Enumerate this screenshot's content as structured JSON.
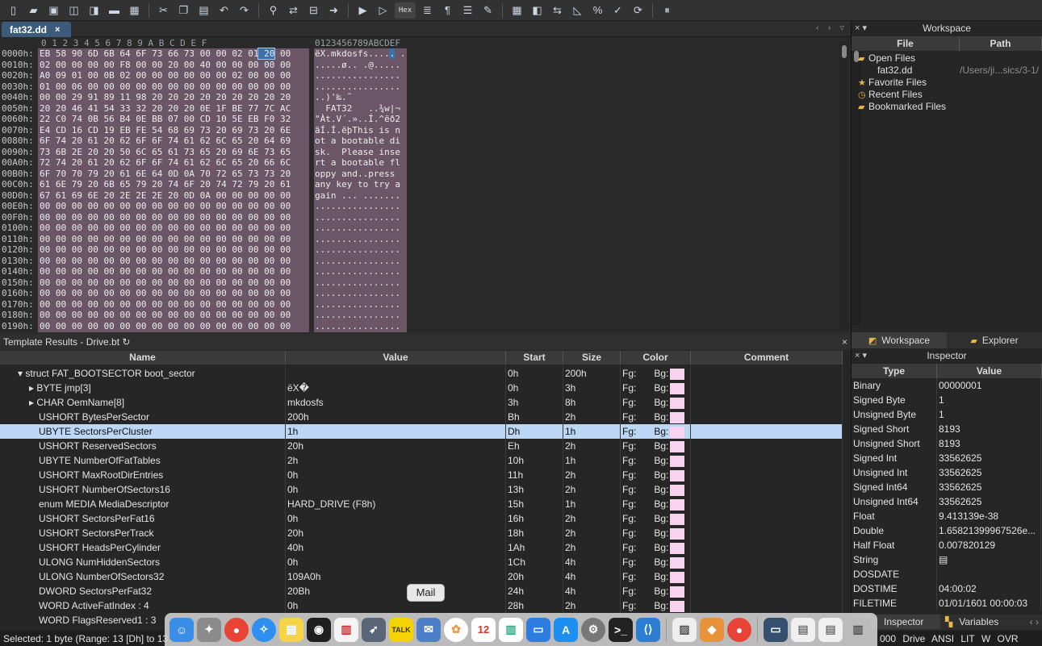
{
  "toolbar": {
    "hex_label": "Hex"
  },
  "editor": {
    "tab_label": "fat32.dd",
    "tab_close": "×",
    "tab_nav": "‹ › ▿"
  },
  "hex_view": {
    "column_header": "0  1  2  3  4  5  6  7  8  9  A  B  C  D  E  F",
    "ascii_header": "0123456789ABCDEF",
    "rows": [
      {
        "addr": "0000h:",
        "hex": "EB 58 90 6D 6B 64 6F 73 66 73 00 00 02 01 20 00",
        "ascii": "ëX.mkdosfs..... ."
      },
      {
        "addr": "0010h:",
        "hex": "02 00 00 00 00 F8 00 00 20 00 40 00 00 00 00 00",
        "ascii": ".....ø.. .@....."
      },
      {
        "addr": "0020h:",
        "hex": "A0 09 01 00 0B 02 00 00 00 00 00 00 02 00 00 00",
        "ascii": "................"
      },
      {
        "addr": "0030h:",
        "hex": "01 00 06 00 00 00 00 00 00 00 00 00 00 00 00 00",
        "ascii": "................"
      },
      {
        "addr": "0040h:",
        "hex": "00 00 29 91 89 11 98 20 20 20 20 20 20 20 20 20",
        "ascii": "..)'‰.˜         "
      },
      {
        "addr": "0050h:",
        "hex": "20 20 46 41 54 33 32 20 20 20 0E 1F BE 77 7C AC",
        "ascii": "  FAT32   ..¾w|¬"
      },
      {
        "addr": "0060h:",
        "hex": "22 C0 74 0B 56 B4 0E BB 07 00 CD 10 5E EB F0 32",
        "ascii": "\"Àt.V´.»..Í.^ëð2"
      },
      {
        "addr": "0070h:",
        "hex": "E4 CD 16 CD 19 EB FE 54 68 69 73 20 69 73 20 6E",
        "ascii": "äÍ.Í.ëþThis is n"
      },
      {
        "addr": "0080h:",
        "hex": "6F 74 20 61 20 62 6F 6F 74 61 62 6C 65 20 64 69",
        "ascii": "ot a bootable di"
      },
      {
        "addr": "0090h:",
        "hex": "73 6B 2E 20 20 50 6C 65 61 73 65 20 69 6E 73 65",
        "ascii": "sk.  Please inse"
      },
      {
        "addr": "00A0h:",
        "hex": "72 74 20 61 20 62 6F 6F 74 61 62 6C 65 20 66 6C",
        "ascii": "rt a bootable fl"
      },
      {
        "addr": "00B0h:",
        "hex": "6F 70 70 79 20 61 6E 64 0D 0A 70 72 65 73 73 20",
        "ascii": "oppy and..press "
      },
      {
        "addr": "00C0h:",
        "hex": "61 6E 79 20 6B 65 79 20 74 6F 20 74 72 79 20 61",
        "ascii": "any key to try a"
      },
      {
        "addr": "00D0h:",
        "hex": "67 61 69 6E 20 2E 2E 2E 20 0D 0A 00 00 00 00 00",
        "ascii": "gain ... ......."
      },
      {
        "addr": "00E0h:",
        "hex": "00 00 00 00 00 00 00 00 00 00 00 00 00 00 00 00",
        "ascii": "................"
      },
      {
        "addr": "00F0h:",
        "hex": "00 00 00 00 00 00 00 00 00 00 00 00 00 00 00 00",
        "ascii": "................"
      },
      {
        "addr": "0100h:",
        "hex": "00 00 00 00 00 00 00 00 00 00 00 00 00 00 00 00",
        "ascii": "................"
      },
      {
        "addr": "0110h:",
        "hex": "00 00 00 00 00 00 00 00 00 00 00 00 00 00 00 00",
        "ascii": "................"
      },
      {
        "addr": "0120h:",
        "hex": "00 00 00 00 00 00 00 00 00 00 00 00 00 00 00 00",
        "ascii": "................"
      },
      {
        "addr": "0130h:",
        "hex": "00 00 00 00 00 00 00 00 00 00 00 00 00 00 00 00",
        "ascii": "................"
      },
      {
        "addr": "0140h:",
        "hex": "00 00 00 00 00 00 00 00 00 00 00 00 00 00 00 00",
        "ascii": "................"
      },
      {
        "addr": "0150h:",
        "hex": "00 00 00 00 00 00 00 00 00 00 00 00 00 00 00 00",
        "ascii": "................"
      },
      {
        "addr": "0160h:",
        "hex": "00 00 00 00 00 00 00 00 00 00 00 00 00 00 00 00",
        "ascii": "................"
      },
      {
        "addr": "0170h:",
        "hex": "00 00 00 00 00 00 00 00 00 00 00 00 00 00 00 00",
        "ascii": "................"
      },
      {
        "addr": "0180h:",
        "hex": "00 00 00 00 00 00 00 00 00 00 00 00 00 00 00 00",
        "ascii": "................"
      },
      {
        "addr": "0190h:",
        "hex": "00 00 00 00 00 00 00 00 00 00 00 00 00 00 00 00",
        "ascii": "................"
      }
    ]
  },
  "template_results": {
    "title": "Template Results - Drive.bt ↻",
    "close": "×",
    "columns": [
      "Name",
      "Value",
      "Start",
      "Size",
      "Color",
      "Comment"
    ],
    "fg_label": "Fg:",
    "bg_label": "Bg:",
    "rows": [
      {
        "name": "▾ struct FAT_BOOTSECTOR boot_sector",
        "value": "",
        "start": "0h",
        "size": "200h"
      },
      {
        "name": "▸ BYTE jmp[3]",
        "value": "ëX�",
        "start": "0h",
        "size": "3h"
      },
      {
        "name": "▸ CHAR OemName[8]",
        "value": "mkdosfs",
        "start": "3h",
        "size": "8h"
      },
      {
        "name": "USHORT BytesPerSector",
        "value": "200h",
        "start": "Bh",
        "size": "2h"
      },
      {
        "name": "UBYTE SectorsPerCluster",
        "value": "1h",
        "start": "Dh",
        "size": "1h"
      },
      {
        "name": "USHORT ReservedSectors",
        "value": "20h",
        "start": "Eh",
        "size": "2h"
      },
      {
        "name": "UBYTE NumberOfFatTables",
        "value": "2h",
        "start": "10h",
        "size": "1h"
      },
      {
        "name": "USHORT MaxRootDirEntries",
        "value": "0h",
        "start": "11h",
        "size": "2h"
      },
      {
        "name": "USHORT NumberOfSectors16",
        "value": "0h",
        "start": "13h",
        "size": "2h"
      },
      {
        "name": "enum MEDIA MediaDescriptor",
        "value": "HARD_DRIVE (F8h)",
        "start": "15h",
        "size": "1h"
      },
      {
        "name": "USHORT SectorsPerFat16",
        "value": "0h",
        "start": "16h",
        "size": "2h"
      },
      {
        "name": "USHORT SectorsPerTrack",
        "value": "20h",
        "start": "18h",
        "size": "2h"
      },
      {
        "name": "USHORT HeadsPerCylinder",
        "value": "40h",
        "start": "1Ah",
        "size": "2h"
      },
      {
        "name": "ULONG NumHiddenSectors",
        "value": "0h",
        "start": "1Ch",
        "size": "4h"
      },
      {
        "name": "ULONG NumberOfSectors32",
        "value": "109A0h",
        "start": "20h",
        "size": "4h"
      },
      {
        "name": "DWORD SectorsPerFat32",
        "value": "20Bh",
        "start": "24h",
        "size": "4h"
      },
      {
        "name": "WORD ActiveFatIndex : 4",
        "value": "0h",
        "start": "28h",
        "size": "2h"
      },
      {
        "name": "WORD FlagsReserved1 : 3",
        "value": "",
        "start": "",
        "size": ""
      }
    ]
  },
  "workspace": {
    "controls": "× ▾",
    "title": "Workspace",
    "columns": [
      "File",
      "Path"
    ],
    "items": [
      {
        "label": "Open Files",
        "path": ""
      },
      {
        "label": "fat32.dd",
        "path": "/Users/ji...sics/3-1/"
      },
      {
        "label": "Favorite Files",
        "path": ""
      },
      {
        "label": "Recent Files",
        "path": ""
      },
      {
        "label": "Bookmarked Files",
        "path": ""
      }
    ]
  },
  "right_tabs": {
    "workspace": "Workspace",
    "explorer": "Explorer"
  },
  "inspector": {
    "controls": "× ▾",
    "title": "Inspector",
    "columns": [
      "Type",
      "Value"
    ],
    "rows": [
      {
        "type": "Binary",
        "value": "00000001"
      },
      {
        "type": "Signed Byte",
        "value": "1"
      },
      {
        "type": "Unsigned Byte",
        "value": "1"
      },
      {
        "type": "Signed Short",
        "value": "8193"
      },
      {
        "type": "Unsigned Short",
        "value": "8193"
      },
      {
        "type": "Signed Int",
        "value": "33562625"
      },
      {
        "type": "Unsigned Int",
        "value": "33562625"
      },
      {
        "type": "Signed Int64",
        "value": "33562625"
      },
      {
        "type": "Unsigned Int64",
        "value": "33562625"
      },
      {
        "type": "Float",
        "value": "9.413139e-38"
      },
      {
        "type": "Double",
        "value": "1.65821399967526e..."
      },
      {
        "type": "Half Float",
        "value": "0.007820129"
      },
      {
        "type": "String",
        "value": "▤"
      },
      {
        "type": "DOSDATE",
        "value": ""
      },
      {
        "type": "DOSTIME",
        "value": "04:00:02"
      },
      {
        "type": "FILETIME",
        "value": "01/01/1601 00:00:03"
      }
    ]
  },
  "bottom_tabs": {
    "inspector": "Inspector",
    "variables": "Variables",
    "nav": "‹ ›"
  },
  "status": {
    "selection": "Selected: 1 byte (Range: 13 [Dh] to 13",
    "right": "000 Drive ANSI LIT W OVR"
  },
  "dock": {
    "tooltip": "Mail"
  }
}
